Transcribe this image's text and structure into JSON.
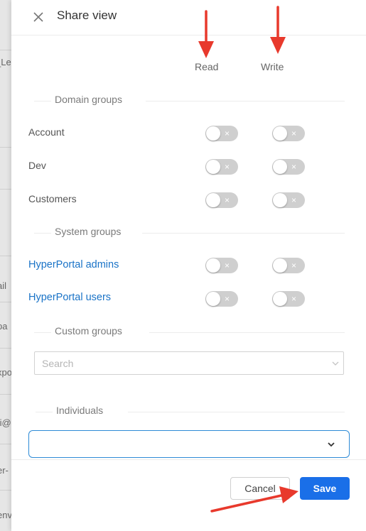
{
  "background_fragments": [
    "_Lea",
    "ail",
    "pa",
    "xpo",
    "ti@",
    "er-",
    "env"
  ],
  "dialog": {
    "title": "Share view",
    "close_icon": "close-icon"
  },
  "columns": {
    "read": "Read",
    "write": "Write"
  },
  "sections": {
    "domain_groups": "Domain groups",
    "system_groups": "System groups",
    "custom_groups": "Custom groups",
    "individuals": "Individuals"
  },
  "domain_groups": [
    {
      "label": "Account",
      "read": false,
      "write": false
    },
    {
      "label": "Dev",
      "read": false,
      "write": false
    },
    {
      "label": "Customers",
      "read": false,
      "write": false
    }
  ],
  "system_groups": [
    {
      "label": "HyperPortal admins",
      "read": false,
      "write": false
    },
    {
      "label": "HyperPortal users",
      "read": false,
      "write": false
    }
  ],
  "toggle_off_glyph": "×",
  "custom_groups_search": {
    "placeholder": "Search",
    "value": ""
  },
  "individuals_select": {
    "value": ""
  },
  "footer": {
    "cancel_label": "Cancel",
    "save_label": "Save"
  },
  "colors": {
    "link": "#1a73c7",
    "primary": "#1a6fe8",
    "toggle_off": "#cfcfcf",
    "annotation_arrow": "#e8392c"
  }
}
